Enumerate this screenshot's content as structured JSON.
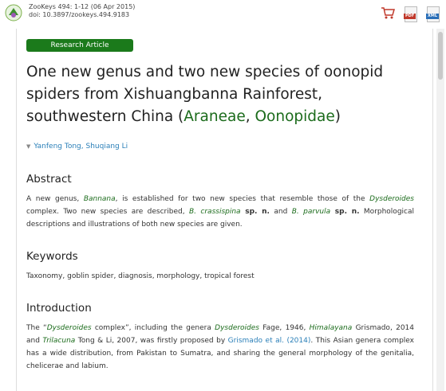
{
  "header": {
    "citation_line1": "ZooKeys 494: 1-12 (06 Apr 2015)",
    "citation_line2": "doi: 10.3897/zookeys.494.9183",
    "pdf_tag": "PDF",
    "xml_tag": "XML"
  },
  "colors": {
    "green": "#1b6b1b",
    "badge": "#1b7a1b",
    "link": "#2a7fb8"
  },
  "article": {
    "badge": "Research Article",
    "title_line1": "One new genus and two new species of oonopid",
    "title_line2": "spiders from Xishuangbanna Rainforest,",
    "title_line3_pre": "southwestern China (",
    "title_tax1": "Araneae",
    "title_sep": ", ",
    "title_tax2": "Oonopidae",
    "title_end": ")",
    "author1": "Yanfeng Tong",
    "author_sep": ", ",
    "author2": "Shuqiang Li"
  },
  "abstract": {
    "heading": "Abstract",
    "t1": "A new genus, ",
    "genus": "Bannana",
    "t2": ", is established for two new species that resemble those of the ",
    "dys": "Dysderoides",
    "t3": " complex. Two new species are described, ",
    "sp1": "B. crassispina",
    "spn1": " sp. n.",
    "t4": " and ",
    "sp2": "B. parvula",
    "spn2": " sp. n.",
    "t5": " Morphological descriptions and illustrations of both new species are given."
  },
  "keywords": {
    "heading": "Keywords",
    "text": "Taxonomy, goblin spider, diagnosis, morphology, tropical forest"
  },
  "intro": {
    "heading": "Introduction",
    "t1": "The “",
    "dys": "Dysderoides",
    "t2": " complex”, including the genera ",
    "dys2": "Dysderoides",
    "t3": " Fage, 1946, ",
    "him": "Himalayana",
    "t4": " Grismado, 2014 and ",
    "tri": "Trilacuna",
    "t5": " Tong & Li, 2007, was firstly proposed by ",
    "ref": "Grismado et al. (2014)",
    "t6": ". This Asian genera complex has a wide distribution, from Pakistan to Sumatra, and sharing the general morphology of the genitalia, chelicerae and labium."
  }
}
